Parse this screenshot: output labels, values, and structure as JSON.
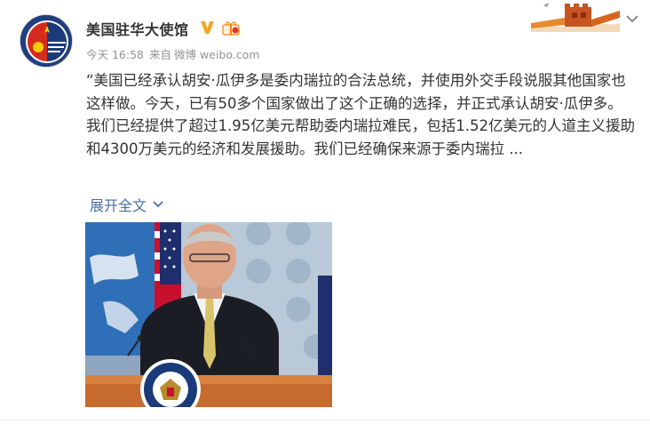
{
  "post": {
    "author_name": "美国驻华大使馆",
    "time": "今天 16:58",
    "source_prefix": "来自",
    "source_app": "微博",
    "source_site": "weibo.com",
    "paragraph1": "“美国已经承认胡安·瓜伊多是委内瑞拉的合法总统，并使用外交手段说服其他国家也这样做。今天，已有50多个国家做出了这个正确的选择，并正式承认胡安·瓜伊多。",
    "paragraph2": "我们已经提供了超过1.95亿美元帮助委内瑞拉难民，包括1.52亿美元的人道主义援助和4300万美元的经济和发展援助。我们已经确保来源于委内瑞拉 ...",
    "expand_label": "展开全文"
  },
  "icons": {
    "verified": "verified-v-icon",
    "gift": "gift-icon",
    "chevron": "chevron-down-icon",
    "expand_chevron": "chevron-down-icon"
  },
  "colors": {
    "link": "#476ea0",
    "verified": "#f6a623",
    "meta": "#939393"
  }
}
